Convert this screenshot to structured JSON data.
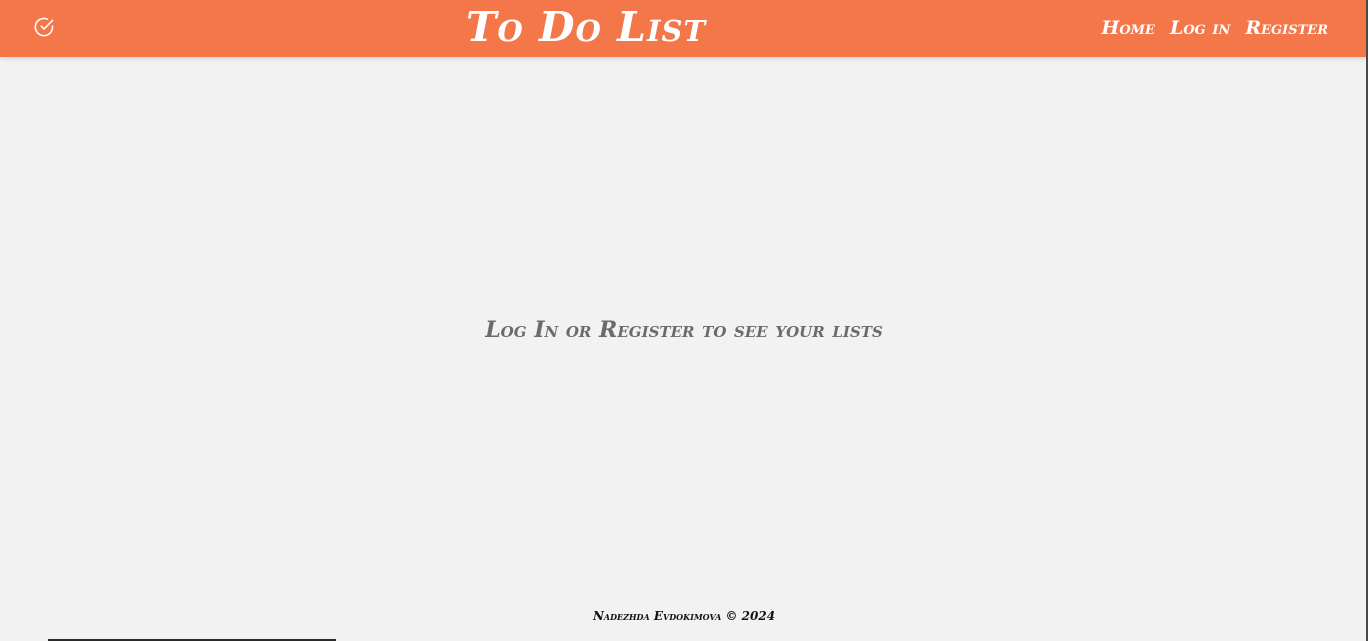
{
  "header": {
    "logo_icon": "check-circle-icon",
    "title": "To Do List",
    "nav": {
      "home": "Home",
      "login": "Log in",
      "register": "Register"
    }
  },
  "main": {
    "message": "Log In or Register to see your lists"
  },
  "footer": {
    "text": "Nadezhda Evdokimova © 2024"
  },
  "colors": {
    "accent": "#f4774a",
    "background": "#f2f2f2",
    "header_text": "#ffffff",
    "message_text": "#6b6b6b",
    "footer_text": "#111111"
  }
}
